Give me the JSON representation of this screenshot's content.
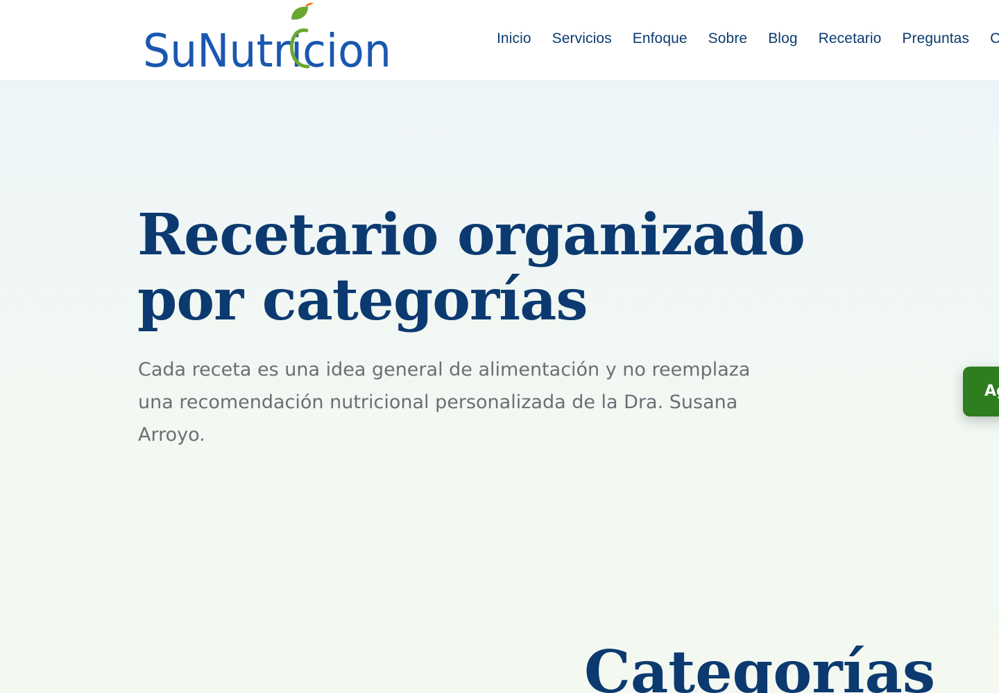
{
  "header": {
    "logo_text": "SuNutricion",
    "nav": [
      {
        "label": "Inicio"
      },
      {
        "label": "Servicios"
      },
      {
        "label": "Enfoque"
      },
      {
        "label": "Sobre"
      },
      {
        "label": "Blog"
      },
      {
        "label": "Recetario"
      },
      {
        "label": "Preguntas"
      },
      {
        "label": "C"
      }
    ]
  },
  "hero": {
    "title_line1": "Recetario organizado",
    "title_line2": "por categorías",
    "subtitle": "Cada receta es una idea general de alimentación y no reemplaza una recomendación nutricional personalizada de la Dra. Susana Arroyo."
  },
  "cta": {
    "label": "Ag"
  },
  "section": {
    "title": "Categorías"
  },
  "colors": {
    "brand_blue": "#1a57b0",
    "heading_navy": "#0c3a70",
    "nav_text": "#0b3b6e",
    "leaf_green": "#6aa732",
    "leaf_orange": "#f07a1e",
    "cta_green": "#2e7d1e",
    "body_text": "#6a6f75"
  }
}
